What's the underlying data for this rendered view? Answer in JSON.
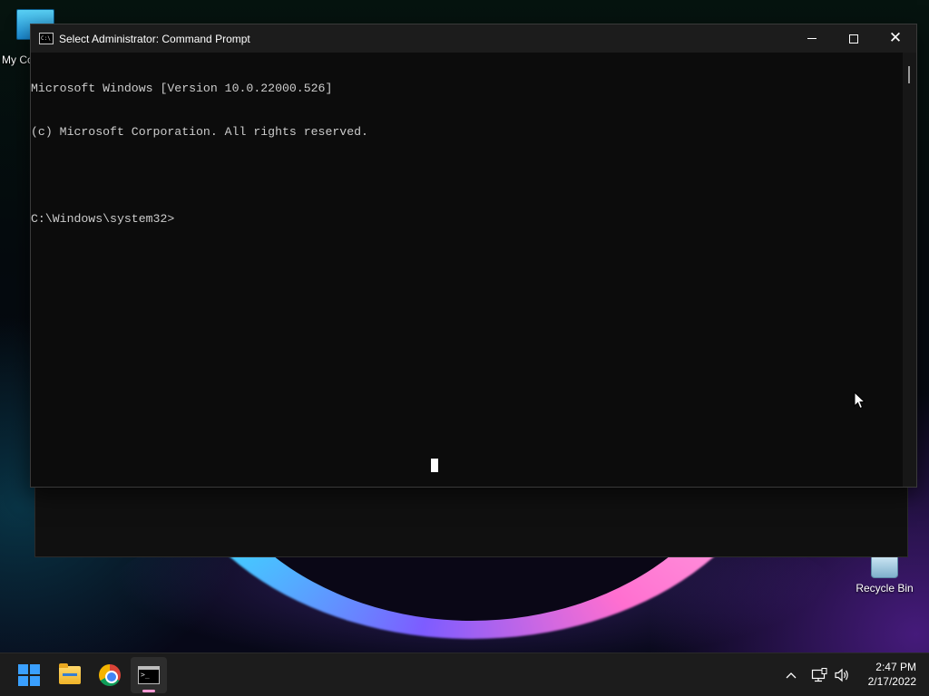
{
  "desktop": {
    "icons": [
      {
        "label": "My Computer",
        "visible_label": "My Co",
        "icon": "computer-icon"
      },
      {
        "label": "Recycle Bin",
        "icon": "recycle-bin-icon"
      }
    ]
  },
  "window": {
    "title": "Select Administrator: Command Prompt",
    "title_icon": "cmd-icon",
    "title_icon_text": "C:\\",
    "buttons": [
      "minimize",
      "maximize",
      "close"
    ],
    "close_glyph": "✕"
  },
  "console": {
    "lines": [
      "Microsoft Windows [Version 10.0.22000.526]",
      "(c) Microsoft Corporation. All rights reserved.",
      "",
      "C:\\Windows\\system32>"
    ]
  },
  "taskbar": {
    "apps": [
      {
        "name": "Start",
        "icon": "windows-logo-icon"
      },
      {
        "name": "File Explorer",
        "icon": "folder-icon"
      },
      {
        "name": "Google Chrome",
        "icon": "chrome-icon"
      },
      {
        "name": "Command Prompt",
        "icon": "cmd-icon",
        "active": true
      }
    ],
    "tray": {
      "chevron": "^",
      "network_icon": "network-icon",
      "volume_icon": "volume-icon"
    },
    "clock": {
      "time": "2:47 PM",
      "date": "2/17/2022"
    }
  },
  "colors": {
    "accent": "#3aa0ff",
    "active_indicator": "#ff9ad5",
    "console_bg": "#0c0c0c",
    "console_text": "#cccccc"
  }
}
